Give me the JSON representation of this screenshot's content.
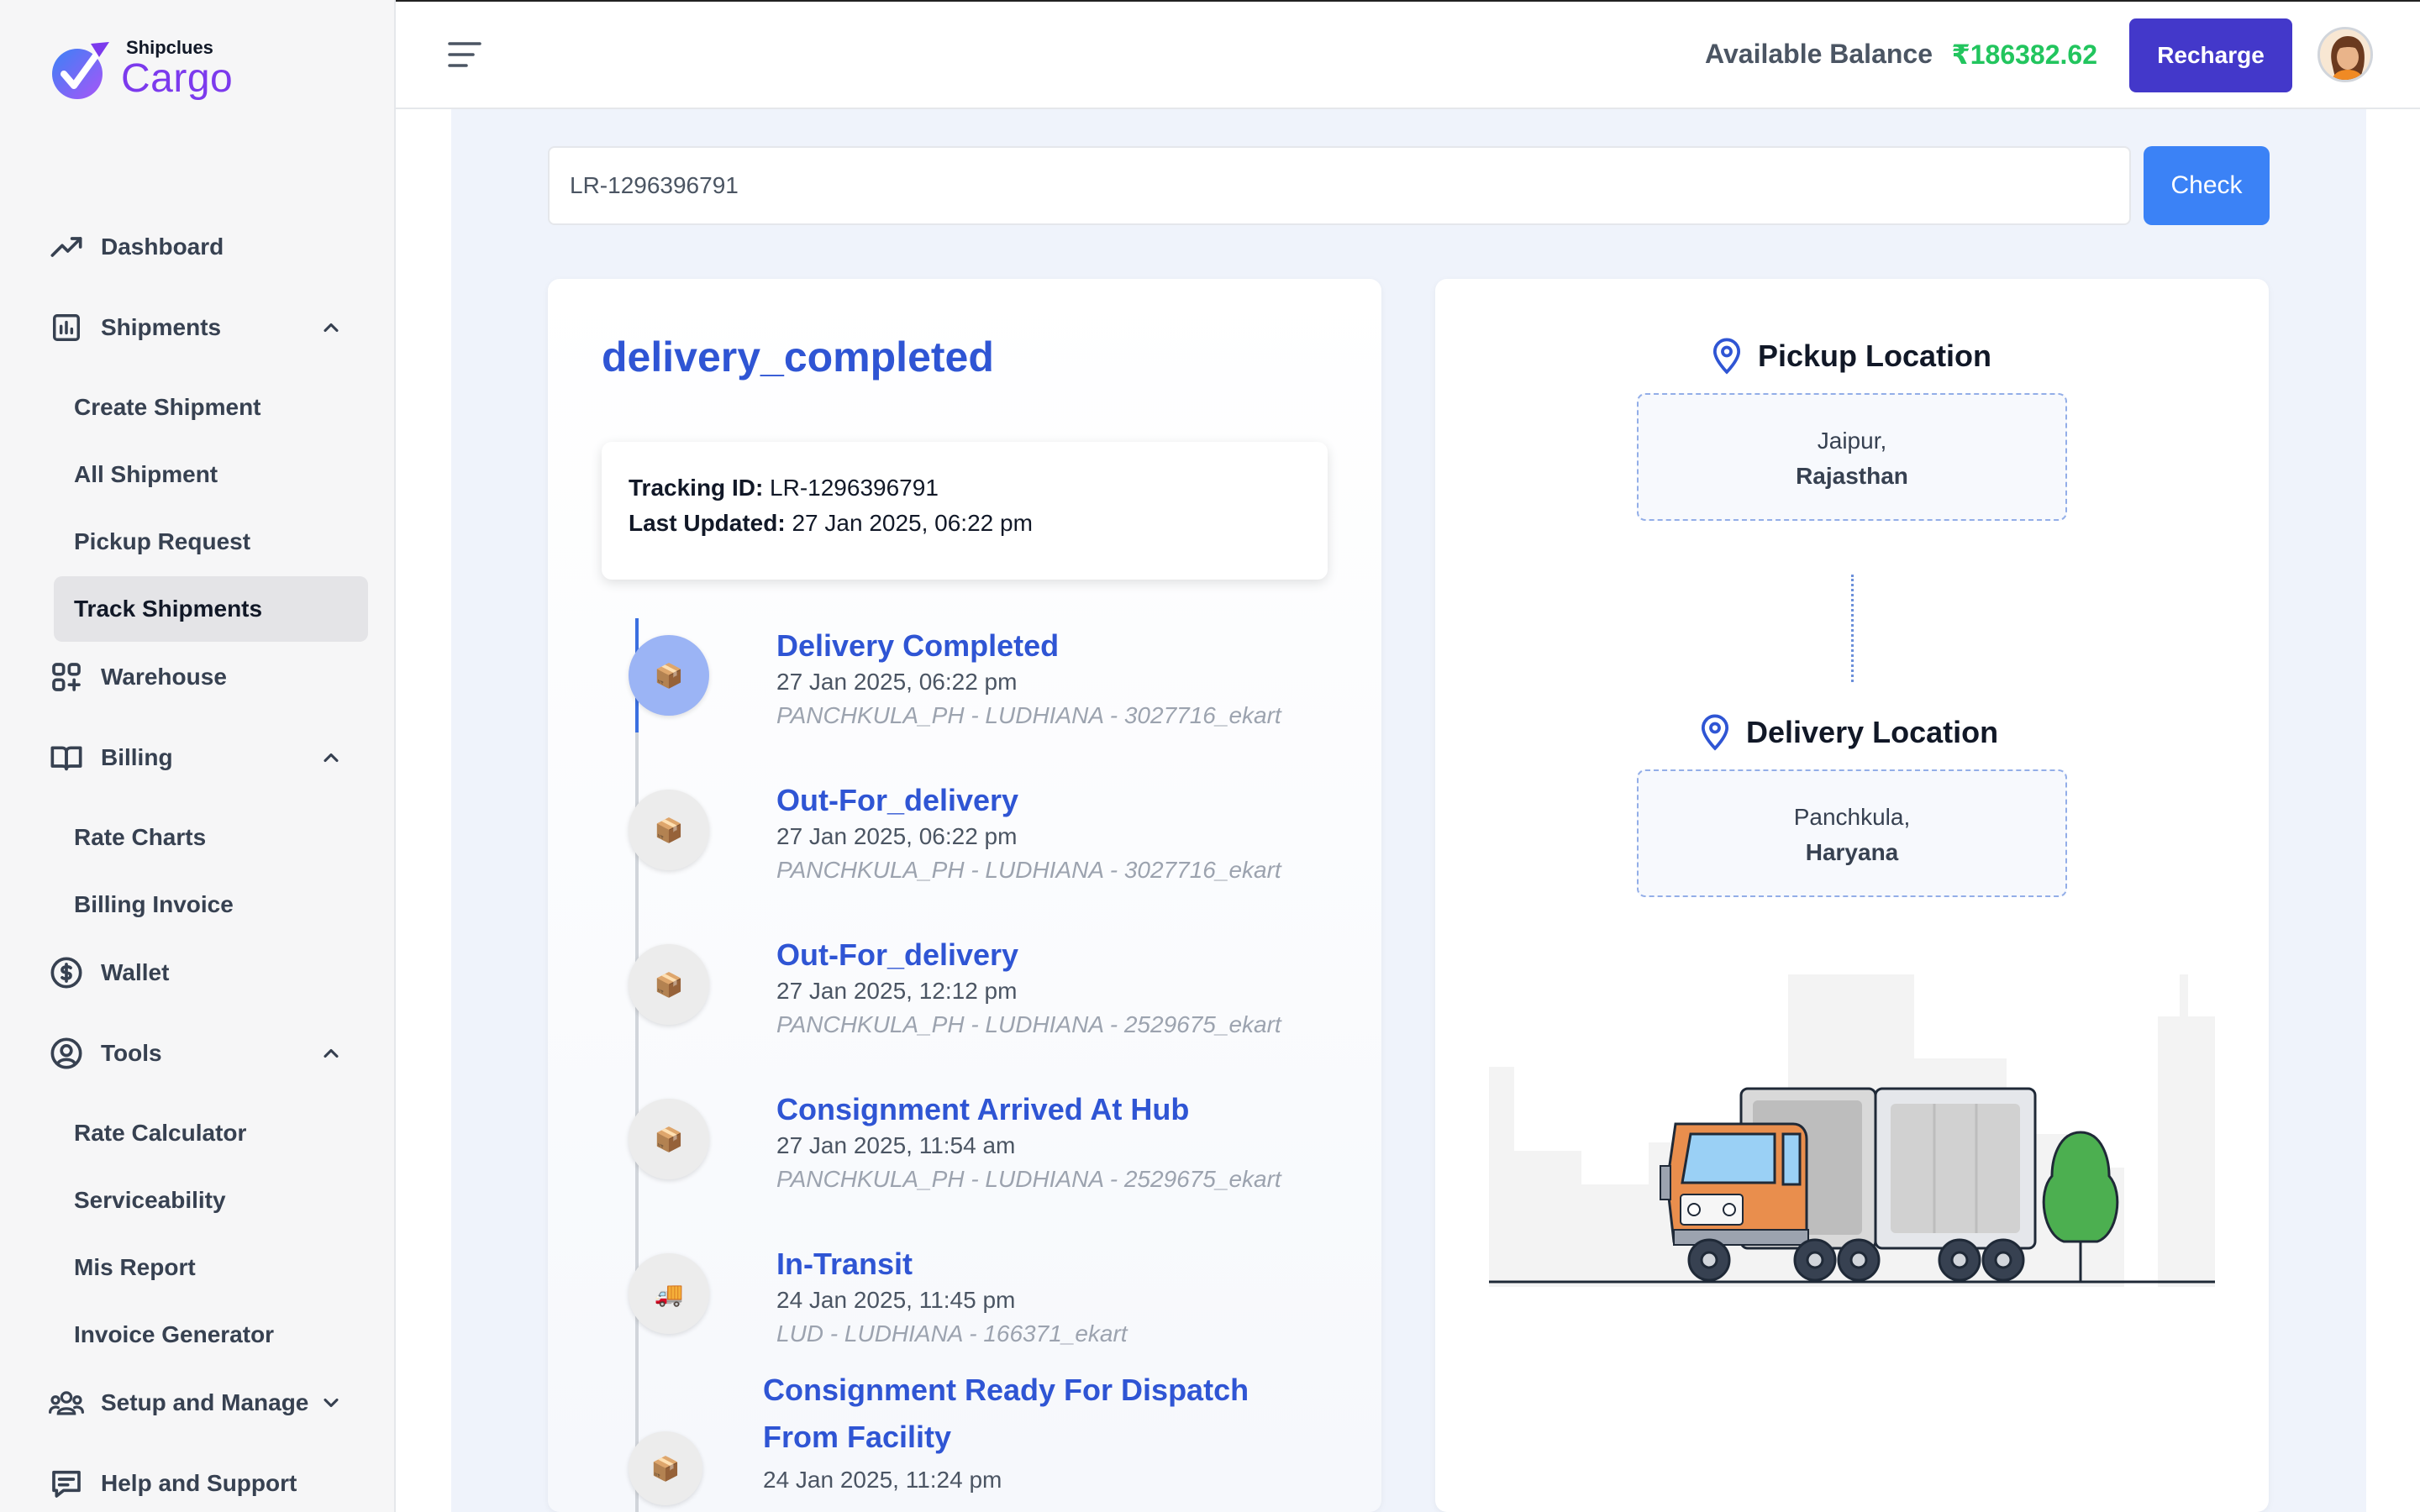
{
  "brand": {
    "small": "Shipclues",
    "big": "Cargo",
    "accent": "#7c3aed"
  },
  "sidebar": {
    "items": [
      {
        "label": "Dashboard",
        "icon": "trending-up-icon"
      },
      {
        "label": "Shipments",
        "icon": "bar-chart-icon",
        "expanded": true,
        "children": [
          "Create Shipment",
          "All Shipment",
          "Pickup Request",
          "Track Shipments"
        ]
      },
      {
        "label": "Warehouse",
        "icon": "grid-plus-icon"
      },
      {
        "label": "Billing",
        "icon": "book-icon",
        "expanded": true,
        "children": [
          "Rate Charts",
          "Billing Invoice"
        ]
      },
      {
        "label": "Wallet",
        "icon": "dollar-circle-icon"
      },
      {
        "label": "Tools",
        "icon": "user-circle-icon",
        "expanded": true,
        "children": [
          "Rate Calculator",
          "Serviceability",
          "Mis Report",
          "Invoice Generator"
        ]
      },
      {
        "label": "Setup and Manage",
        "icon": "users-icon",
        "expanded": false
      },
      {
        "label": "Help and Support",
        "icon": "chat-icon"
      }
    ],
    "active": "Track Shipments"
  },
  "header": {
    "balance_label": "Available Balance",
    "balance_value": "₹186382.62",
    "recharge_label": "Recharge",
    "balance_color": "#22c55e"
  },
  "search": {
    "value": "LR-1296396791",
    "check_label": "Check"
  },
  "tracking": {
    "status": "delivery_completed",
    "tracking_id_label": "Tracking ID:",
    "tracking_id": "LR-1296396791",
    "last_updated_label": "Last Updated:",
    "last_updated": "27 Jan 2025, 06:22 pm",
    "events": [
      {
        "title": "Delivery Completed",
        "time": "27 Jan 2025, 06:22 pm",
        "location": "PANCHKULA_PH - LUDHIANA - 3027716_ekart",
        "icon": "package-icon"
      },
      {
        "title": "Out-For_delivery",
        "time": "27 Jan 2025, 06:22 pm",
        "location": "PANCHKULA_PH - LUDHIANA - 3027716_ekart",
        "icon": "package-icon"
      },
      {
        "title": "Out-For_delivery",
        "time": "27 Jan 2025, 12:12 pm",
        "location": "PANCHKULA_PH - LUDHIANA - 2529675_ekart",
        "icon": "package-icon"
      },
      {
        "title": "Consignment Arrived At Hub",
        "time": "27 Jan 2025, 11:54 am",
        "location": "PANCHKULA_PH - LUDHIANA - 2529675_ekart",
        "icon": "package-icon"
      },
      {
        "title": "In-Transit",
        "time": "24 Jan 2025, 11:45 pm",
        "location": "LUD - LUDHIANA - 166371_ekart",
        "icon": "truck-icon"
      },
      {
        "title_line1": "Consignment Ready For Dispatch",
        "title_line2": "From Facility",
        "time": "24 Jan 2025, 11:24 pm",
        "icon": "package-icon"
      }
    ]
  },
  "locations": {
    "pickup_label": "Pickup Location",
    "pickup_city": "Jaipur,",
    "pickup_state": "Rajasthan",
    "delivery_label": "Delivery Location",
    "delivery_city": "Panchkula,",
    "delivery_state": "Haryana"
  }
}
